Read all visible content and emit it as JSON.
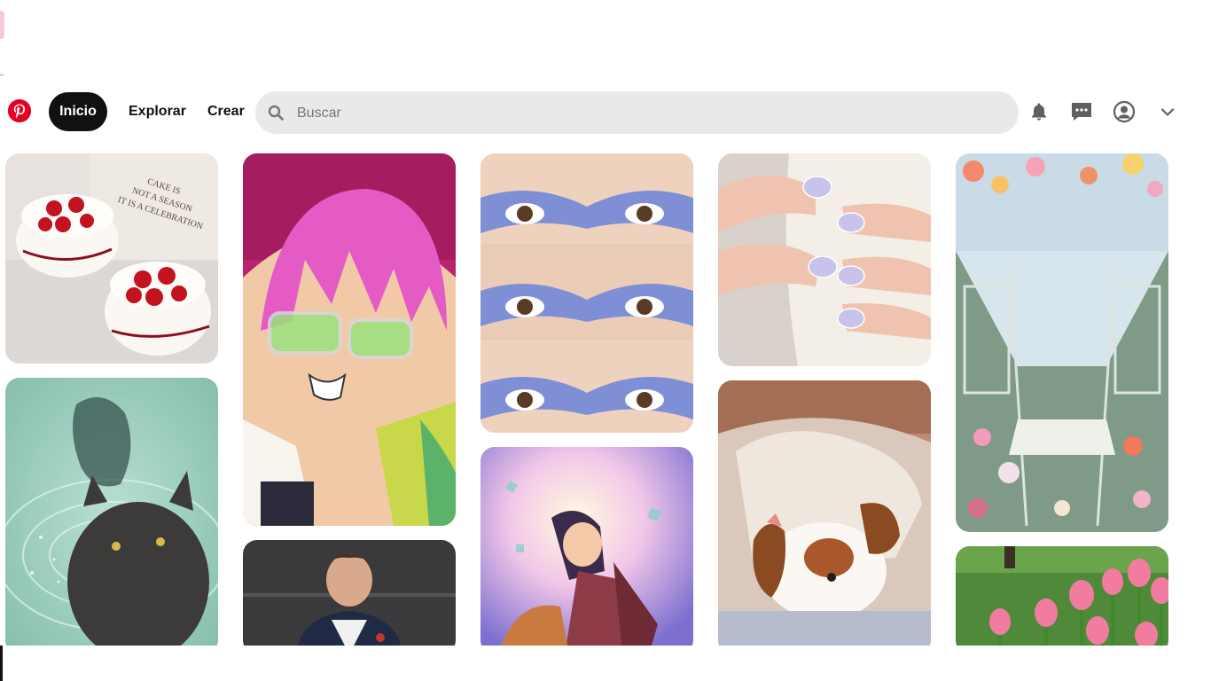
{
  "nav": {
    "logo_icon": "pinterest-logo",
    "home_label": "Inicio",
    "explore_label": "Explorar",
    "create_label": "Crear"
  },
  "search": {
    "placeholder": "Buscar",
    "value": "",
    "icon": "search-icon"
  },
  "header_icons": [
    "bell-icon",
    "messages-icon",
    "profile-icon",
    "chevron-down-icon"
  ],
  "colors": {
    "brand": "#e60023",
    "active_tab": "#111111",
    "search_bg": "#e9e9e9"
  },
  "pins": [
    {
      "subject": "strawberry-cakes",
      "caption": "CAKE IS NOT A SEASON IT IS A CELEBRATION"
    },
    {
      "subject": "black-cat-in-water"
    },
    {
      "subject": "anime-boy-pink-hair-green-glasses"
    },
    {
      "subject": "young-man-portrait"
    },
    {
      "subject": "blue-eye-makeup"
    },
    {
      "subject": "anime-illustration"
    },
    {
      "subject": "pastel-nails-with-mug"
    },
    {
      "subject": "sleeping-puppy"
    },
    {
      "subject": "flower-filled-train"
    },
    {
      "subject": "pink-tulips-in-park"
    }
  ]
}
